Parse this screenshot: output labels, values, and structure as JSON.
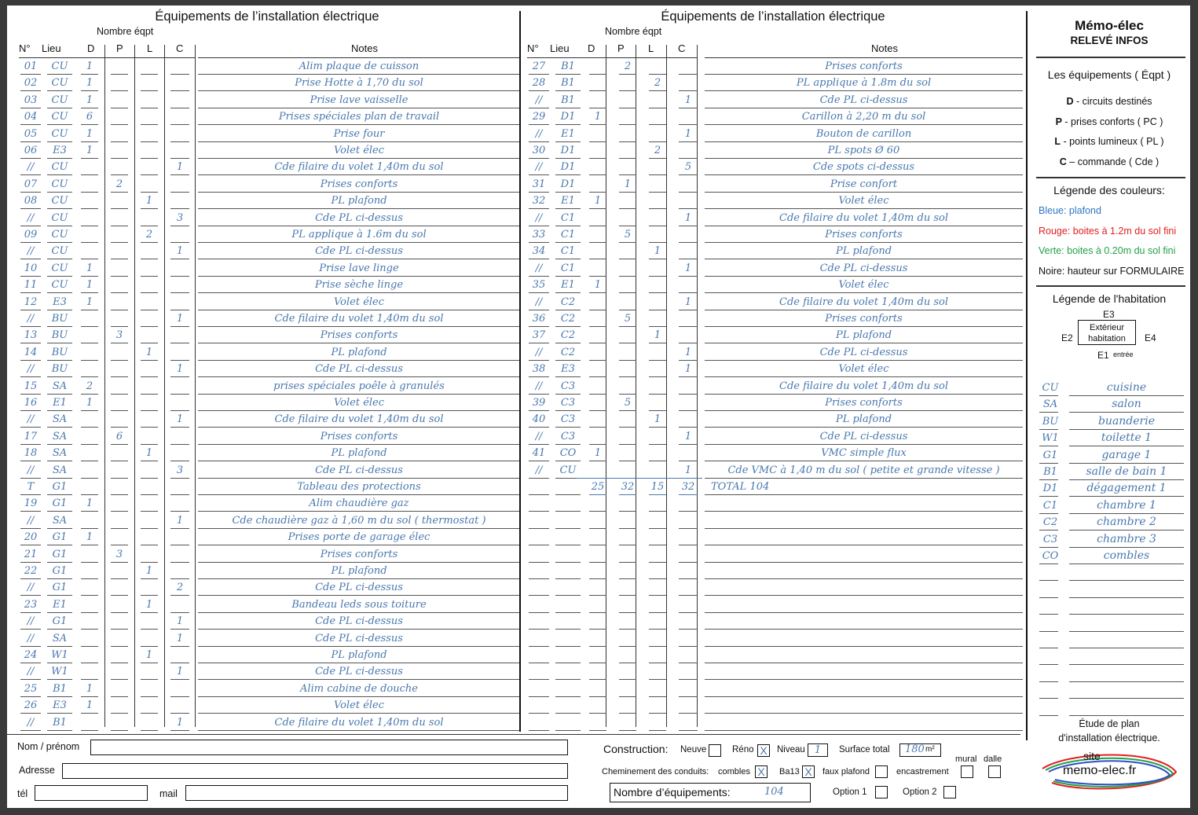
{
  "panel_title": "Équipements de l’installation électrique",
  "nombre_label": "Nombre éqpt",
  "headers": {
    "num": "N°",
    "lieu": "Lieu",
    "d": "D",
    "p": "P",
    "l": "L",
    "c": "C",
    "notes": "Notes"
  },
  "left_rows": [
    {
      "num": "01",
      "lieu": "CU",
      "d": "1",
      "p": "",
      "l": "",
      "c": "",
      "note": "Alim plaque de cuisson"
    },
    {
      "num": "02",
      "lieu": "CU",
      "d": "1",
      "p": "",
      "l": "",
      "c": "",
      "note": "Prise  Hotte à 1,70 du sol"
    },
    {
      "num": "03",
      "lieu": "CU",
      "d": "1",
      "p": "",
      "l": "",
      "c": "",
      "note": "Prise lave vaisselle"
    },
    {
      "num": "04",
      "lieu": "CU",
      "d": "6",
      "p": "",
      "l": "",
      "c": "",
      "note": "Prises spéciales plan de travail"
    },
    {
      "num": "05",
      "lieu": "CU",
      "d": "1",
      "p": "",
      "l": "",
      "c": "",
      "note": "Prise  four"
    },
    {
      "num": "06",
      "lieu": "E3",
      "d": "1",
      "p": "",
      "l": "",
      "c": "",
      "note": "Volet élec"
    },
    {
      "num": "//",
      "lieu": "CU",
      "d": "",
      "p": "",
      "l": "",
      "c": "1",
      "note": "Cde filaire du volet 1,40m du sol"
    },
    {
      "num": "07",
      "lieu": "CU",
      "d": "",
      "p": "2",
      "l": "",
      "c": "",
      "note": "Prises conforts"
    },
    {
      "num": "08",
      "lieu": "CU",
      "d": "",
      "p": "",
      "l": "1",
      "c": "",
      "note": "PL plafond"
    },
    {
      "num": "//",
      "lieu": "CU",
      "d": "",
      "p": "",
      "l": "",
      "c": "3",
      "note": "Cde PL ci-dessus"
    },
    {
      "num": "09",
      "lieu": "CU",
      "d": "",
      "p": "",
      "l": "2",
      "c": "",
      "note": "PL applique à 1.6m du sol"
    },
    {
      "num": "//",
      "lieu": "CU",
      "d": "",
      "p": "",
      "l": "",
      "c": "1",
      "note": "Cde PL ci-dessus"
    },
    {
      "num": "10",
      "lieu": "CU",
      "d": "1",
      "p": "",
      "l": "",
      "c": "",
      "note": "Prise lave linge"
    },
    {
      "num": "11",
      "lieu": "CU",
      "d": "1",
      "p": "",
      "l": "",
      "c": "",
      "note": "Prise sèche linge"
    },
    {
      "num": "12",
      "lieu": "E3",
      "d": "1",
      "p": "",
      "l": "",
      "c": "",
      "note": "Volet élec"
    },
    {
      "num": "//",
      "lieu": "BU",
      "d": "",
      "p": "",
      "l": "",
      "c": "1",
      "note": "Cde filaire du volet 1,40m du sol"
    },
    {
      "num": "13",
      "lieu": "BU",
      "d": "",
      "p": "3",
      "l": "",
      "c": "",
      "note": "Prises conforts"
    },
    {
      "num": "14",
      "lieu": "BU",
      "d": "",
      "p": "",
      "l": "1",
      "c": "",
      "note": "PL plafond"
    },
    {
      "num": "//",
      "lieu": "BU",
      "d": "",
      "p": "",
      "l": "",
      "c": "1",
      "note": "Cde PL ci-dessus"
    },
    {
      "num": "15",
      "lieu": "SA",
      "d": "2",
      "p": "",
      "l": "",
      "c": "",
      "note": "prises spéciales poêle à granulés"
    },
    {
      "num": "16",
      "lieu": "E1",
      "d": "1",
      "p": "",
      "l": "",
      "c": "",
      "note": "Volet élec"
    },
    {
      "num": "//",
      "lieu": "SA",
      "d": "",
      "p": "",
      "l": "",
      "c": "1",
      "note": "Cde filaire du volet 1,40m du sol"
    },
    {
      "num": "17",
      "lieu": "SA",
      "d": "",
      "p": "6",
      "l": "",
      "c": "",
      "note": "Prises conforts"
    },
    {
      "num": "18",
      "lieu": "SA",
      "d": "",
      "p": "",
      "l": "1",
      "c": "",
      "note": "PL plafond"
    },
    {
      "num": "//",
      "lieu": "SA",
      "d": "",
      "p": "",
      "l": "",
      "c": "3",
      "note": "Cde  PL ci-dessus"
    },
    {
      "num": "T",
      "lieu": "G1",
      "d": "",
      "p": "",
      "l": "",
      "c": "",
      "note": "Tableau des protections"
    },
    {
      "num": "19",
      "lieu": "G1",
      "d": "1",
      "p": "",
      "l": "",
      "c": "",
      "note": "Alim chaudière gaz"
    },
    {
      "num": "//",
      "lieu": "SA",
      "d": "",
      "p": "",
      "l": "",
      "c": "1",
      "note": "Cde chaudière gaz à 1,60 m du sol ( thermostat )"
    },
    {
      "num": "20",
      "lieu": "G1",
      "d": "1",
      "p": "",
      "l": "",
      "c": "",
      "note": "Prises porte de garage élec"
    },
    {
      "num": "21",
      "lieu": "G1",
      "d": "",
      "p": "3",
      "l": "",
      "c": "",
      "note": "Prises conforts"
    },
    {
      "num": "22",
      "lieu": "G1",
      "d": "",
      "p": "",
      "l": "1",
      "c": "",
      "note": "PL plafond"
    },
    {
      "num": "//",
      "lieu": "G1",
      "d": "",
      "p": "",
      "l": "",
      "c": "2",
      "note": "Cde  PL ci-dessus"
    },
    {
      "num": "23",
      "lieu": "E1",
      "d": "",
      "p": "",
      "l": "1",
      "c": "",
      "note": "Bandeau leds sous toiture"
    },
    {
      "num": "//",
      "lieu": "G1",
      "d": "",
      "p": "",
      "l": "",
      "c": "1",
      "note": "Cde  PL ci-dessus"
    },
    {
      "num": "//",
      "lieu": "SA",
      "d": "",
      "p": "",
      "l": "",
      "c": "1",
      "note": "Cde  PL ci-dessus"
    },
    {
      "num": "24",
      "lieu": "W1",
      "d": "",
      "p": "",
      "l": "1",
      "c": "",
      "note": "PL plafond"
    },
    {
      "num": "//",
      "lieu": "W1",
      "d": "",
      "p": "",
      "l": "",
      "c": "1",
      "note": "Cde  PL ci-dessus"
    },
    {
      "num": "25",
      "lieu": "B1",
      "d": "1",
      "p": "",
      "l": "",
      "c": "",
      "note": "Alim cabine de douche"
    },
    {
      "num": "26",
      "lieu": "E3",
      "d": "1",
      "p": "",
      "l": "",
      "c": "",
      "note": "Volet élec"
    },
    {
      "num": "//",
      "lieu": "B1",
      "d": "",
      "p": "",
      "l": "",
      "c": "1",
      "note": "Cde filaire du volet 1,40m du sol"
    }
  ],
  "right_rows": [
    {
      "num": "27",
      "lieu": "B1",
      "d": "",
      "p": "2",
      "l": "",
      "c": "",
      "note": "Prises conforts"
    },
    {
      "num": "28",
      "lieu": "B1",
      "d": "",
      "p": "",
      "l": "2",
      "c": "",
      "note": "PL applique à 1.8m du sol"
    },
    {
      "num": "//",
      "lieu": "B1",
      "d": "",
      "p": "",
      "l": "",
      "c": "1",
      "note": "Cde  PL ci-dessus"
    },
    {
      "num": "29",
      "lieu": "D1",
      "d": "1",
      "p": "",
      "l": "",
      "c": "",
      "note": "Carillon à 2,20 m du sol"
    },
    {
      "num": "//",
      "lieu": "E1",
      "d": "",
      "p": "",
      "l": "",
      "c": "1",
      "note": "Bouton de  carillon"
    },
    {
      "num": "30",
      "lieu": "D1",
      "d": "",
      "p": "",
      "l": "2",
      "c": "",
      "note": "PL spots  Ø 60"
    },
    {
      "num": "//",
      "lieu": "D1",
      "d": "",
      "p": "",
      "l": "",
      "c": "5",
      "note": "Cde  spots ci-dessus"
    },
    {
      "num": "31",
      "lieu": "D1",
      "d": "",
      "p": "1",
      "l": "",
      "c": "",
      "note": "Prise confort"
    },
    {
      "num": "32",
      "lieu": "E1",
      "d": "1",
      "p": "",
      "l": "",
      "c": "",
      "note": "Volet élec"
    },
    {
      "num": "//",
      "lieu": "C1",
      "d": "",
      "p": "",
      "l": "",
      "c": "1",
      "note": "Cde filaire du volet 1,40m du sol"
    },
    {
      "num": "33",
      "lieu": "C1",
      "d": "",
      "p": "5",
      "l": "",
      "c": "",
      "note": "Prises conforts"
    },
    {
      "num": "34",
      "lieu": "C1",
      "d": "",
      "p": "",
      "l": "1",
      "c": "",
      "note": "PL plafond"
    },
    {
      "num": "//",
      "lieu": "C1",
      "d": "",
      "p": "",
      "l": "",
      "c": "1",
      "note": "Cde  PL ci-dessus"
    },
    {
      "num": "35",
      "lieu": "E1",
      "d": "1",
      "p": "",
      "l": "",
      "c": "",
      "note": "Volet élec"
    },
    {
      "num": "//",
      "lieu": "C2",
      "d": "",
      "p": "",
      "l": "",
      "c": "1",
      "note": "Cde filaire du volet 1,40m du sol"
    },
    {
      "num": "36",
      "lieu": "C2",
      "d": "",
      "p": "5",
      "l": "",
      "c": "",
      "note": "Prises conforts"
    },
    {
      "num": "37",
      "lieu": "C2",
      "d": "",
      "p": "",
      "l": "1",
      "c": "",
      "note": "PL plafond"
    },
    {
      "num": "//",
      "lieu": "C2",
      "d": "",
      "p": "",
      "l": "",
      "c": "1",
      "note": "Cde  PL ci-dessus"
    },
    {
      "num": "38",
      "lieu": "E3",
      "d": "",
      "p": "",
      "l": "",
      "c": "1",
      "note": "Volet élec"
    },
    {
      "num": "//",
      "lieu": "C3",
      "d": "",
      "p": "",
      "l": "",
      "c": "",
      "note": "Cde filaire du volet 1,40m du sol"
    },
    {
      "num": "39",
      "lieu": "C3",
      "d": "",
      "p": "5",
      "l": "",
      "c": "",
      "note": "Prises conforts"
    },
    {
      "num": "40",
      "lieu": "C3",
      "d": "",
      "p": "",
      "l": "1",
      "c": "",
      "note": "PL plafond"
    },
    {
      "num": "//",
      "lieu": "C3",
      "d": "",
      "p": "",
      "l": "",
      "c": "1",
      "note": "Cde  PL ci-dessus"
    },
    {
      "num": "41",
      "lieu": "CO",
      "d": "1",
      "p": "",
      "l": "",
      "c": "",
      "note": "VMC simple flux"
    },
    {
      "num": "//",
      "lieu": "CU",
      "d": "",
      "p": "",
      "l": "",
      "c": "1",
      "note": "Cde VMC à 1,40 m du sol ( petite et grande vitesse )"
    }
  ],
  "totals": {
    "d": "25",
    "p": "32",
    "l": "15",
    "c": "32",
    "label": "TOTAL   104"
  },
  "memo": {
    "title": "Mémo-élec",
    "subtitle": "RELEVÉ INFOS",
    "equip_title": "Les équipements ( Éqpt )",
    "equip_items": [
      {
        "key": "D",
        "text": " - circuits destinés"
      },
      {
        "key": "P",
        "text": " - prises conforts ( PC )"
      },
      {
        "key": "L",
        "text": " - points lumineux ( PL )"
      },
      {
        "key": "C",
        "text": " – commande ( Cde )"
      }
    ],
    "colors_title": "Légende des couleurs:",
    "color_items": [
      {
        "text": "Bleue: plafond",
        "color": "#2f78c4"
      },
      {
        "text": "Rouge: boites à 1.2m du sol fini",
        "color": "#e02020"
      },
      {
        "text": "Verte: boites à 0.20m du sol fini",
        "color": "#22a24a"
      },
      {
        "text": "Noire: hauteur sur FORMULAIRE",
        "color": "#111111"
      }
    ],
    "habitation_title": "Légende de l'habitation",
    "compass": {
      "e1": "E1",
      "e2": "E2",
      "e3": "E3",
      "e4": "E4",
      "center": "Extérieur habitation",
      "entree": "entrée"
    },
    "rooms": [
      {
        "code": "CU",
        "name": "cuisine"
      },
      {
        "code": "SA",
        "name": "salon"
      },
      {
        "code": "BU",
        "name": "buanderie"
      },
      {
        "code": "W1",
        "name": "toilette 1"
      },
      {
        "code": "G1",
        "name": "garage 1"
      },
      {
        "code": "B1",
        "name": "salle de bain 1"
      },
      {
        "code": "D1",
        "name": "dégagement 1"
      },
      {
        "code": "C1",
        "name": "chambre 1"
      },
      {
        "code": "C2",
        "name": "chambre 2"
      },
      {
        "code": "C3",
        "name": "chambre 3"
      },
      {
        "code": "CO",
        "name": "combles"
      }
    ],
    "footer": "Étude de plan\nd'installation électrique.",
    "site_label": "site",
    "site_url": "memo-elec.fr"
  },
  "form": {
    "name_label": "Nom / prénom",
    "address_label": "Adresse",
    "tel_label": "tél",
    "mail_label": "mail",
    "construction_label": "Construction:",
    "neuve_label": "Neuve",
    "reno_label": "Réno",
    "niveau_label": "Niveau",
    "niveau_value": "1",
    "surface_label": "Surface total",
    "surface_value": "180",
    "surface_unit": "m²",
    "conduits_label": "Cheminement des conduits:",
    "combles_label": "combles",
    "ba13_label": "Ba13",
    "faux_plafond_label": "faux plafond",
    "encastrement_label": "encastrement",
    "mural_label": "mural",
    "dalle_label": "dalle",
    "nombre_label": "Nombre d’équipements:",
    "nombre_value": "104",
    "option1_label": "Option 1",
    "option2_label": "Option 2",
    "check_mark": "X",
    "checked": {
      "reno": true,
      "combles": true,
      "ba13": true
    }
  }
}
